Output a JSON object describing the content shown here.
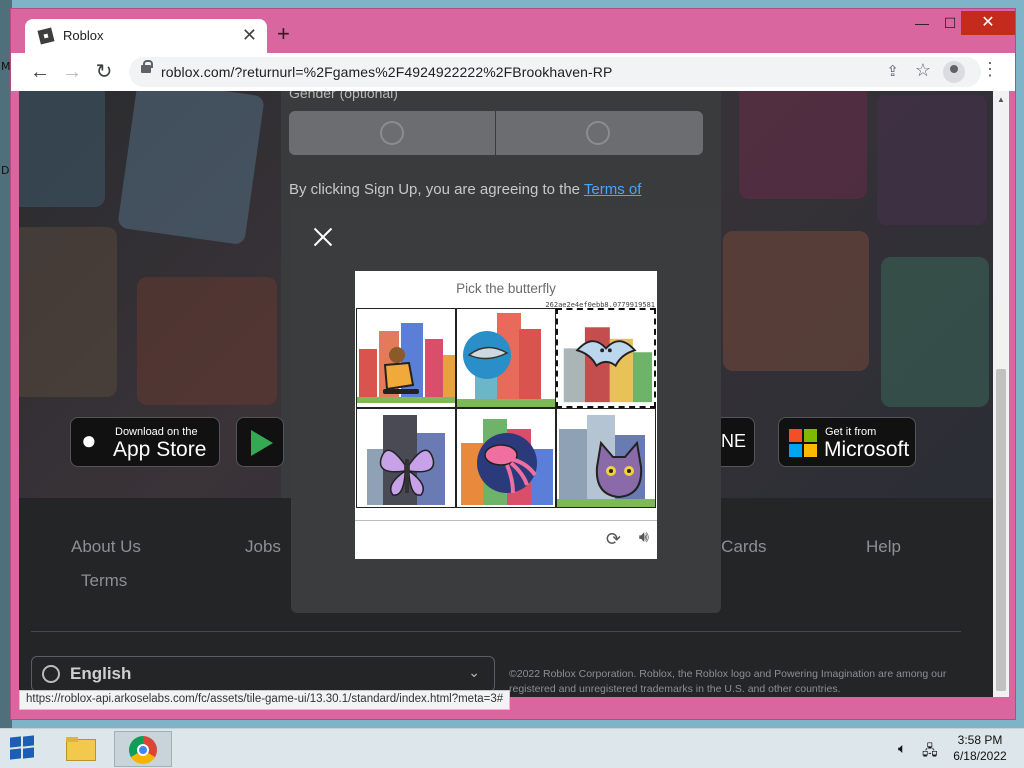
{
  "desktop": {
    "left_labels": [
      "M",
      "D"
    ]
  },
  "browser": {
    "tab": {
      "title": "Roblox",
      "close": "✕"
    },
    "new_tab": "+",
    "window_controls": {
      "minimize": "—",
      "maximize": "☐",
      "close": "✕"
    },
    "nav": {
      "back": "←",
      "forward": "→",
      "reload": "↻"
    },
    "url": "roblox.com/?returnurl=%2Fgames%2F4924922222%2FBrookhaven-RP",
    "status_url": "https://roblox-api.arkoselabs.com/fc/assets/tile-game-ui/13.30.1/standard/index.html?meta=3#"
  },
  "page": {
    "gender_label": "Gender (optional)",
    "agree_text": "By clicking Sign Up, you are agreeing to the ",
    "agree_link": "Terms of",
    "stores": {
      "apple": {
        "small": "Download on the",
        "big": "App Store"
      },
      "xbox_fragment": "ONE",
      "microsoft": {
        "small": "Get it from",
        "big": "Microsoft"
      }
    },
    "footer_links": [
      "About Us",
      "Jobs",
      "ft Cards",
      "Help",
      "Terms"
    ],
    "language": "English",
    "copyright": "©2022 Roblox Corporation. Roblox, the Roblox logo and Powering Imagination are among our registered and unregistered trademarks in the U.S. and other countries."
  },
  "captcha": {
    "prompt": "Pick the butterfly",
    "session_hash": "262ae2e4ef0ebb8.0779919581",
    "tiles": [
      {
        "subject": "skateboarder"
      },
      {
        "subject": "shark"
      },
      {
        "subject": "bat",
        "selected": true
      },
      {
        "subject": "butterfly"
      },
      {
        "subject": "squid"
      },
      {
        "subject": "cat"
      }
    ]
  },
  "taskbar": {
    "time": "3:58 PM",
    "date": "6/18/2022"
  },
  "colors": {
    "window_frame": "#d9669e",
    "modal_bg": "#3b3c3e",
    "link": "#4aa3ff",
    "taskbar": "#dde6ea"
  }
}
